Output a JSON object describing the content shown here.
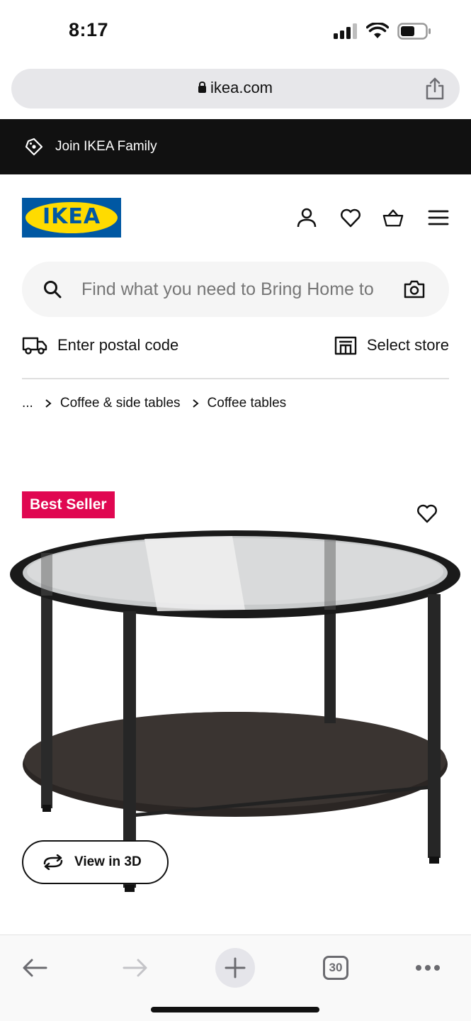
{
  "status": {
    "time": "8:17"
  },
  "browser": {
    "url": "ikea.com",
    "tab_count": "30"
  },
  "family_banner": {
    "label": "Join IKEA Family"
  },
  "header": {
    "logo_text": "IKEA"
  },
  "search": {
    "placeholder": "Find what you need to Bring Home to"
  },
  "location": {
    "postal_label": "Enter postal code",
    "store_label": "Select store"
  },
  "breadcrumb": {
    "ellipsis": "...",
    "items": [
      "Coffee & side tables",
      "Coffee tables"
    ]
  },
  "product": {
    "badge": "Best Seller",
    "view3d_label": "View in 3D"
  },
  "colors": {
    "brand_blue": "#0058a3",
    "brand_yellow": "#ffdb00",
    "badge": "#e00751",
    "banner": "#111111"
  }
}
